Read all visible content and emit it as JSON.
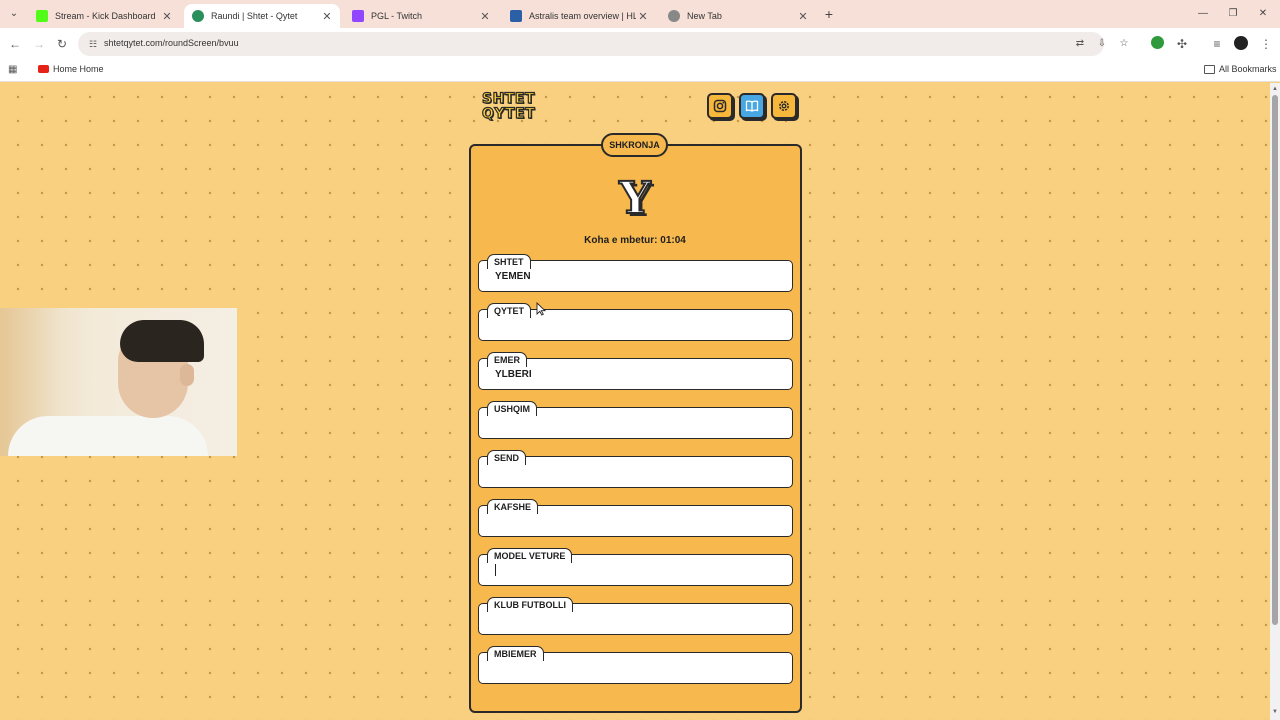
{
  "browser": {
    "tabs": [
      {
        "title": "Stream - Kick Dashboard",
        "favicon_color": "#53fc18"
      },
      {
        "title": "Raundi | Shtet - Qytet",
        "favicon_color": "#2a8f5a"
      },
      {
        "title": "PGL - Twitch",
        "favicon_color": "#9146ff"
      },
      {
        "title": "Astralis team overview | HLTV.o",
        "favicon_color": "#2b5fa8"
      },
      {
        "title": "New Tab",
        "favicon_color": "#888888"
      }
    ],
    "active_tab_index": 1,
    "url": "shtetqytet.com/roundScreen/bvuu",
    "bookmarks": {
      "home": "Home Home",
      "all": "All Bookmarks"
    }
  },
  "app": {
    "logo_top": "SHTET",
    "logo_bottom": "QYTET",
    "buttons": [
      {
        "name": "instagram-icon",
        "color": "#f7b73a"
      },
      {
        "name": "book-icon",
        "color": "#48a6e3"
      },
      {
        "name": "gear-icon",
        "color": "#f7b73a"
      }
    ]
  },
  "round": {
    "header": "SHKRONJA",
    "letter": "Y",
    "timer_label": "Koha e mbetur: 01:04",
    "fields": [
      {
        "label": "SHTET",
        "value": "YEMEN"
      },
      {
        "label": "QYTET",
        "value": ""
      },
      {
        "label": "EMER",
        "value": "YLBERI"
      },
      {
        "label": "USHQIM",
        "value": ""
      },
      {
        "label": "SEND",
        "value": ""
      },
      {
        "label": "KAFSHE",
        "value": ""
      },
      {
        "label": "MODEL VETURE",
        "value": ""
      },
      {
        "label": "KLUB FUTBOLLI",
        "value": ""
      },
      {
        "label": "MBIEMER",
        "value": ""
      }
    ],
    "focused_field_index": 6
  },
  "colors": {
    "page_bg": "#f9cf80",
    "card_bg": "#f7b84d",
    "accent_blue": "#48a6e3",
    "outline": "#2a2a2a"
  }
}
